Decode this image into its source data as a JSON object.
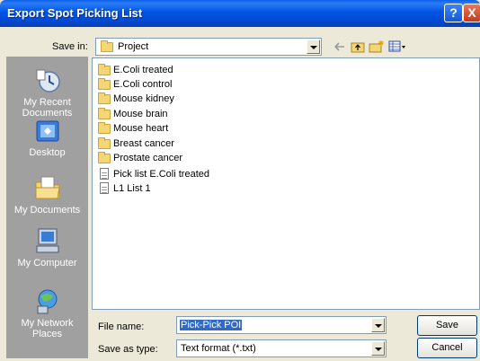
{
  "window": {
    "title": "Export Spot Picking List",
    "help_glyph": "?",
    "close_glyph": "X"
  },
  "toolbar": {
    "save_in_label": "Save in:",
    "save_in_value": "Project",
    "icons": [
      "back-arrow-icon",
      "up-folder-icon",
      "new-folder-icon",
      "views-menu-icon"
    ]
  },
  "places": [
    {
      "id": "recent",
      "label": "My Recent Documents"
    },
    {
      "id": "desktop",
      "label": "Desktop"
    },
    {
      "id": "mydocs",
      "label": "My Documents"
    },
    {
      "id": "computer",
      "label": "My Computer"
    },
    {
      "id": "network",
      "label": "My Network Places"
    }
  ],
  "files": [
    {
      "type": "folder",
      "name": "E.Coli treated"
    },
    {
      "type": "folder",
      "name": "E.Coli control"
    },
    {
      "type": "folder",
      "name": "Mouse kidney"
    },
    {
      "type": "folder",
      "name": "Mouse brain"
    },
    {
      "type": "folder",
      "name": "Mouse heart"
    },
    {
      "type": "folder",
      "name": "Breast cancer"
    },
    {
      "type": "folder",
      "name": "Prostate cancer"
    },
    {
      "type": "file",
      "name": "Pick list E.Coli treated"
    },
    {
      "type": "file",
      "name": "L1 List 1"
    }
  ],
  "form": {
    "file_name_label": "File name:",
    "file_name_value": "Pick-Pick POI",
    "save_as_type_label": "Save as type:",
    "save_as_type_value": "Text format (*.txt)"
  },
  "buttons": {
    "save": "Save",
    "cancel": "Cancel"
  },
  "colors": {
    "title_bar": "#0054e3",
    "selection": "#316ac5",
    "places_bar": "#a0a0a0",
    "dialog_bg": "#ece9d8"
  }
}
